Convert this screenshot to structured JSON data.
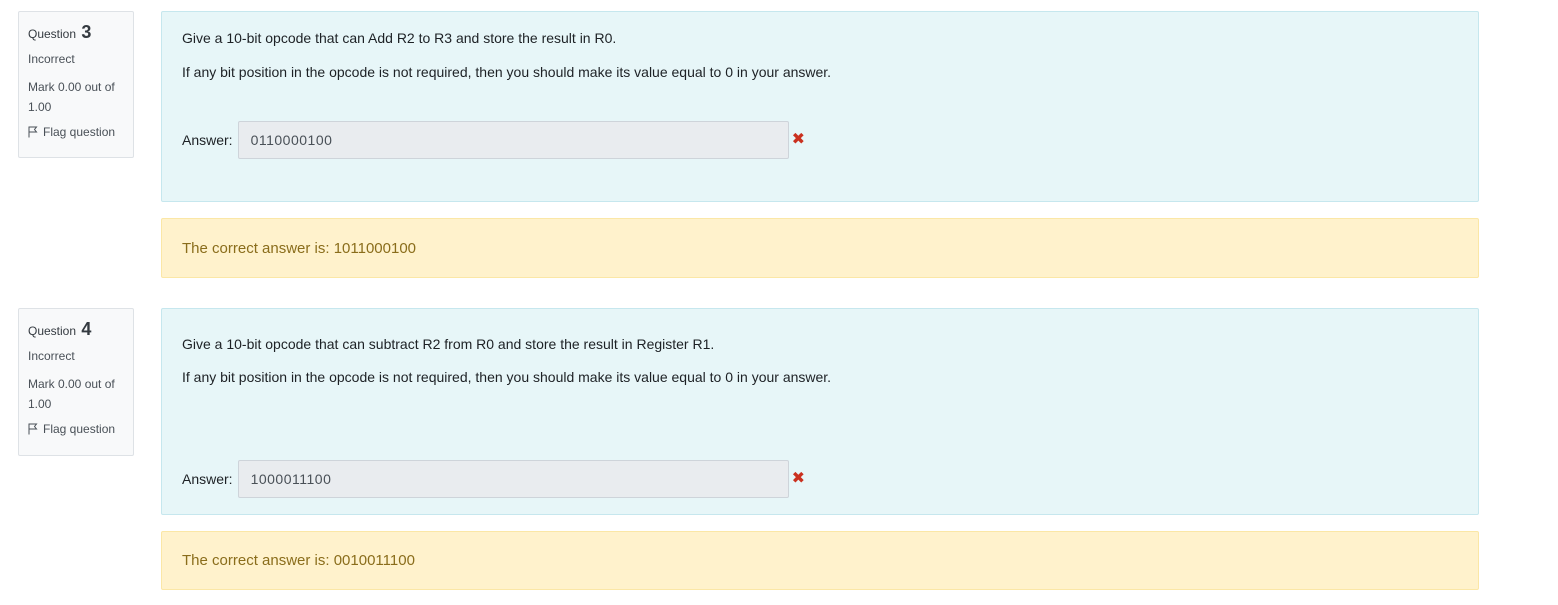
{
  "questions": [
    {
      "label": "Question",
      "number": "3",
      "state": "Incorrect",
      "grade_line1": "Mark 0.00 out of",
      "grade_line2": "1.00",
      "flag_label": "Flag question",
      "text_line1": "Give a 10-bit opcode that can Add R2 to R3 and store the result in R0.",
      "text_line2": "If any bit position in the opcode is not required, then you should make its value equal to 0 in your answer.",
      "answer_label": "Answer:",
      "answer_value": "0110000100",
      "feedback": "The correct answer is: 1011000100"
    },
    {
      "label": "Question",
      "number": "4",
      "state": "Incorrect",
      "grade_line1": "Mark 0.00 out of",
      "grade_line2": "1.00",
      "flag_label": "Flag question",
      "text_line1": "Give a 10-bit opcode that can subtract R2 from R0 and store the result in Register R1.",
      "text_line2": "If any bit position in the opcode is not required, then you should make its value equal to 0 in your answer.",
      "answer_label": "Answer:",
      "answer_value": "1000011100",
      "feedback": "The correct answer is: 0010011100"
    }
  ],
  "colors": {
    "formulation_bg": "#e7f6f8",
    "feedback_bg": "#fff2cc",
    "incorrect_mark": "#ca3120"
  }
}
